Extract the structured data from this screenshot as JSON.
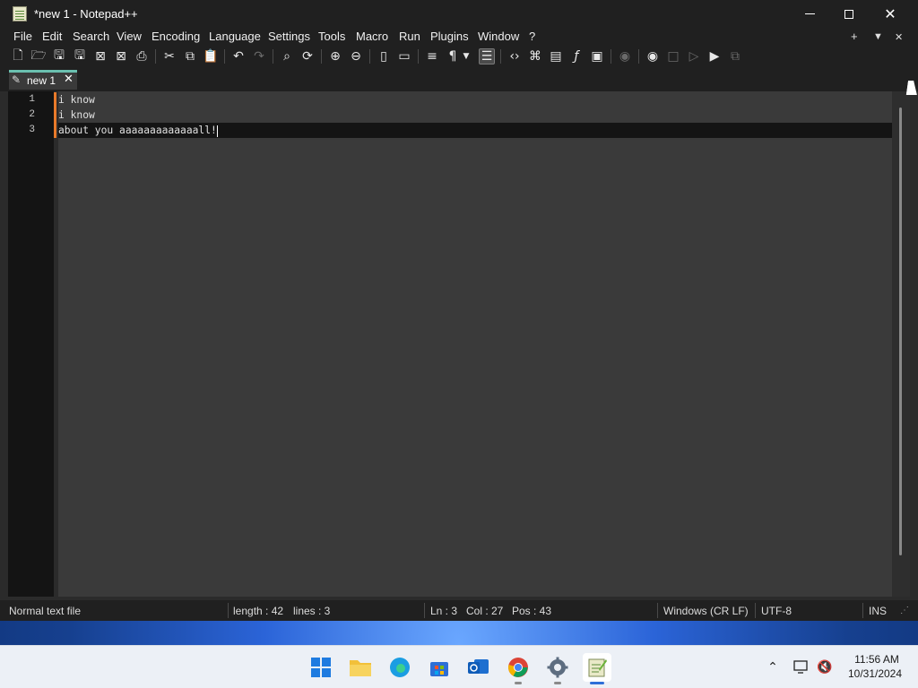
{
  "window": {
    "title": "*new 1 - Notepad++"
  },
  "menu": {
    "items": [
      "File",
      "Edit",
      "Search",
      "View",
      "Encoding",
      "Language",
      "Settings",
      "Tools",
      "Macro",
      "Run",
      "Plugins",
      "Window",
      "?"
    ],
    "right": {
      "add": "+",
      "dropdown": "▼",
      "close": "✕"
    }
  },
  "tab": {
    "label": "new 1",
    "close": "✕"
  },
  "editor": {
    "line_numbers": [
      "1",
      "2",
      "3"
    ],
    "lines": [
      "i know",
      "i know",
      "about you aaaaaaaaaaaaall!"
    ],
    "current_line_index": 3
  },
  "status": {
    "file_type": "Normal text file",
    "length": "length : 42",
    "lines": "lines : 3",
    "ln": "Ln : 3",
    "col": "Col : 27",
    "pos": "Pos : 43",
    "eol": "Windows (CR LF)",
    "encoding": "UTF-8",
    "mode": "INS"
  },
  "clock": {
    "time": "11:56 AM",
    "date": "10/31/2024"
  },
  "colors": {
    "accent_tab": "#6ac0b0",
    "change_marker": "#e87a2a",
    "taskbar_focus": "#2e6fd8"
  }
}
